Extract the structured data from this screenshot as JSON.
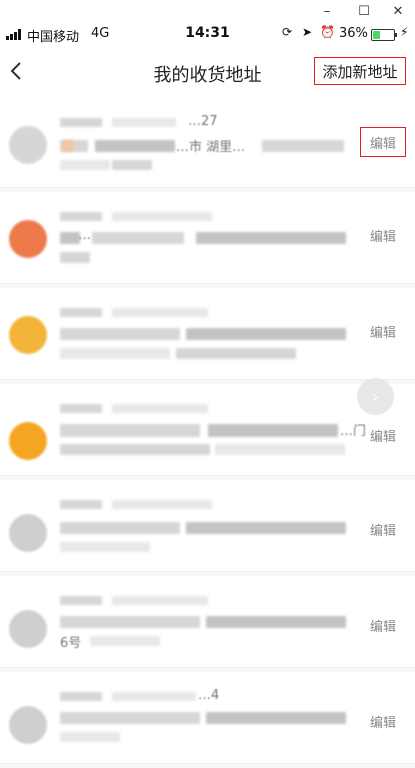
{
  "window": {
    "minimize": "–",
    "maximize": "☐",
    "close": "✕"
  },
  "status_bar": {
    "carrier": "中国移动",
    "network": "4G",
    "time": "14:31",
    "battery_percent": "36%",
    "battery_level": 0.36,
    "icons": [
      "signal-icon",
      "rotation-lock-icon",
      "location-icon",
      "alarm-icon",
      "battery-icon",
      "charging-icon"
    ]
  },
  "nav": {
    "title": "我的收货地址",
    "add_label": "添加新地址",
    "back_icon": "chevron-left-icon"
  },
  "addresses": [
    {
      "edit_label": "编辑",
      "peek_line1": "…27",
      "peek_line2": "…市 湖里…",
      "avatar_color": "#d6d6d6",
      "edit_highlighted": true
    },
    {
      "edit_label": "编辑",
      "peek_line1": "",
      "peek_line2": "…",
      "avatar_color": "#ec7a4a",
      "edit_highlighted": false
    },
    {
      "edit_label": "编辑",
      "peek_line1": "",
      "peek_line2": "",
      "avatar_color": "#f3b43a",
      "edit_highlighted": false
    },
    {
      "edit_label": "编辑",
      "peek_line1": "",
      "peek_line2": "…门",
      "avatar_color": "#f4a623",
      "edit_highlighted": false
    },
    {
      "edit_label": "编辑",
      "peek_line1": "",
      "peek_line2": "",
      "avatar_color": "#cfcfcf",
      "edit_highlighted": false
    },
    {
      "edit_label": "编辑",
      "peek_line1": "",
      "peek_line2": "6号",
      "avatar_color": "#cfcfcf",
      "edit_highlighted": false
    },
    {
      "edit_label": "编辑",
      "peek_line1": "…4",
      "peek_line2": "",
      "avatar_color": "#cfcfcf",
      "edit_highlighted": false
    }
  ],
  "floating_button": {
    "icon": "chevron-right-icon",
    "glyph": "›"
  }
}
